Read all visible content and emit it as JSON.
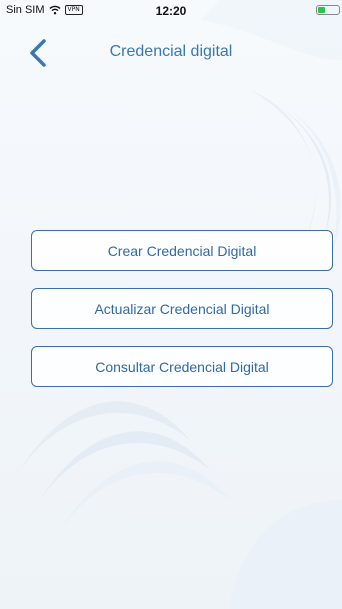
{
  "status_bar": {
    "carrier": "Sin SIM",
    "vpn": "VPN",
    "time": "12:20",
    "battery_level": 0.35,
    "battery_color": "#2fc24a"
  },
  "nav": {
    "back_icon": "chevron-left",
    "title": "Credencial digital"
  },
  "actions": [
    {
      "label": "Crear Credencial Digital"
    },
    {
      "label": "Actualizar Credencial Digital"
    },
    {
      "label": "Consultar Credencial Digital"
    }
  ],
  "colors": {
    "accent": "#3a78ad",
    "button_border": "#3b6fa6"
  }
}
